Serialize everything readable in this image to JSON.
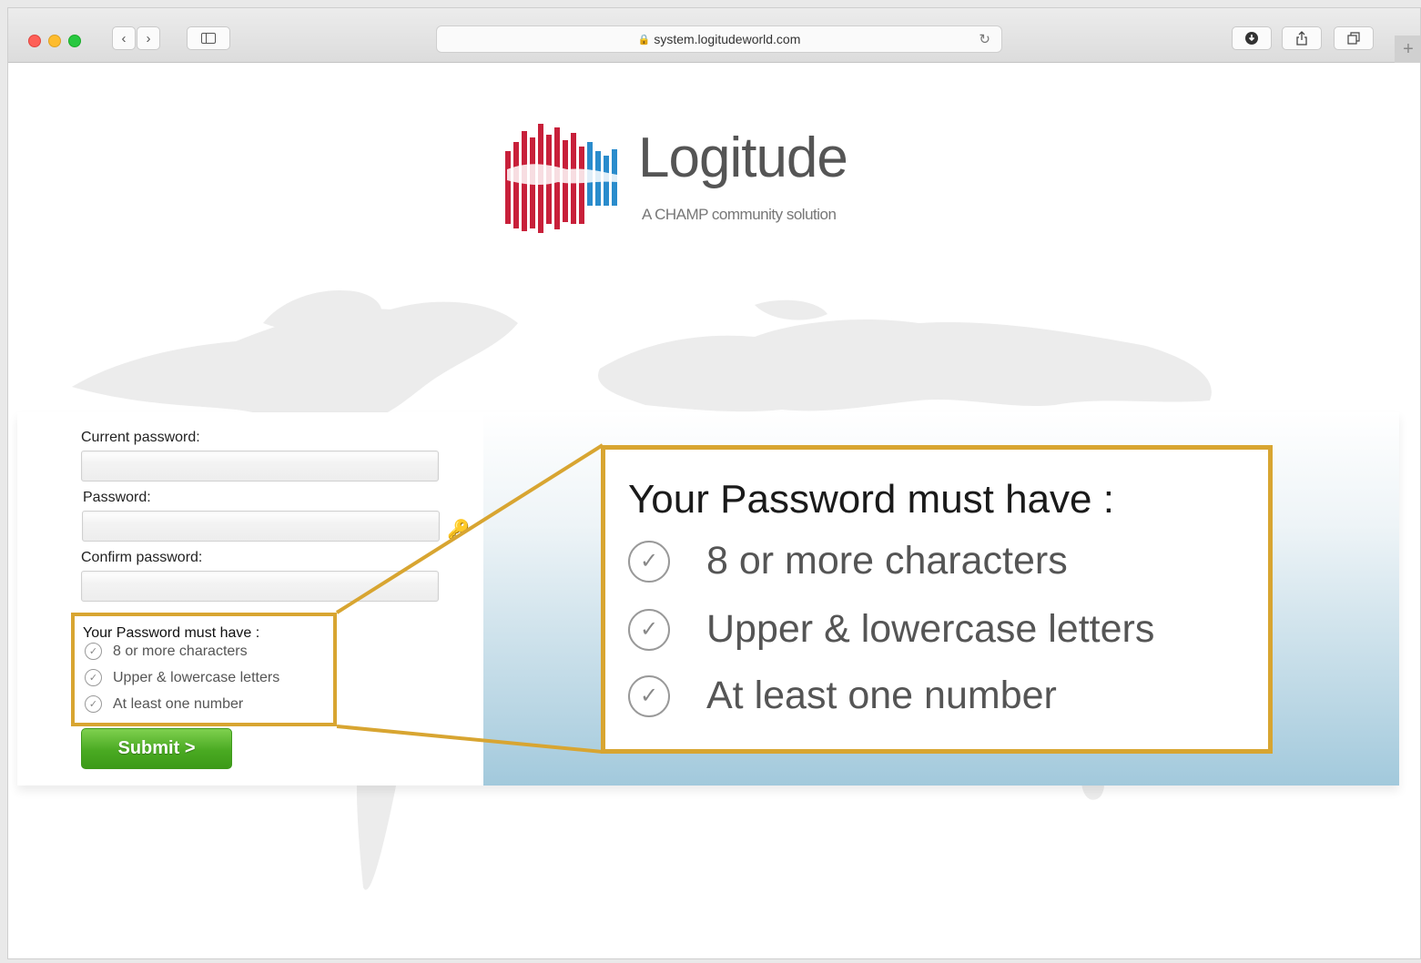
{
  "browser": {
    "url": "system.logitudeworld.com",
    "lock_glyph": "🔒",
    "reload_glyph": "↻",
    "back_glyph": "‹",
    "forward_glyph": "›",
    "new_tab_glyph": "+"
  },
  "brand": {
    "name": "Logitude",
    "tagline": "A CHAMP community solution",
    "logo_red": "#c8203a",
    "logo_blue": "#2a8ccc"
  },
  "form": {
    "current_password_label": "Current password:",
    "current_password_value": "",
    "password_label": "Password:",
    "password_value": "",
    "confirm_password_label": "Confirm password:",
    "confirm_password_value": "",
    "key_glyph": "🔑",
    "submit_label": "Submit >"
  },
  "requirements": {
    "title": "Your Password must have :",
    "check_glyph": "✓",
    "items": [
      "8 or more characters",
      "Upper & lowercase letters",
      "At least one number"
    ]
  },
  "colors": {
    "highlight": "#d8a531",
    "submit_green": "#4aaa22"
  }
}
